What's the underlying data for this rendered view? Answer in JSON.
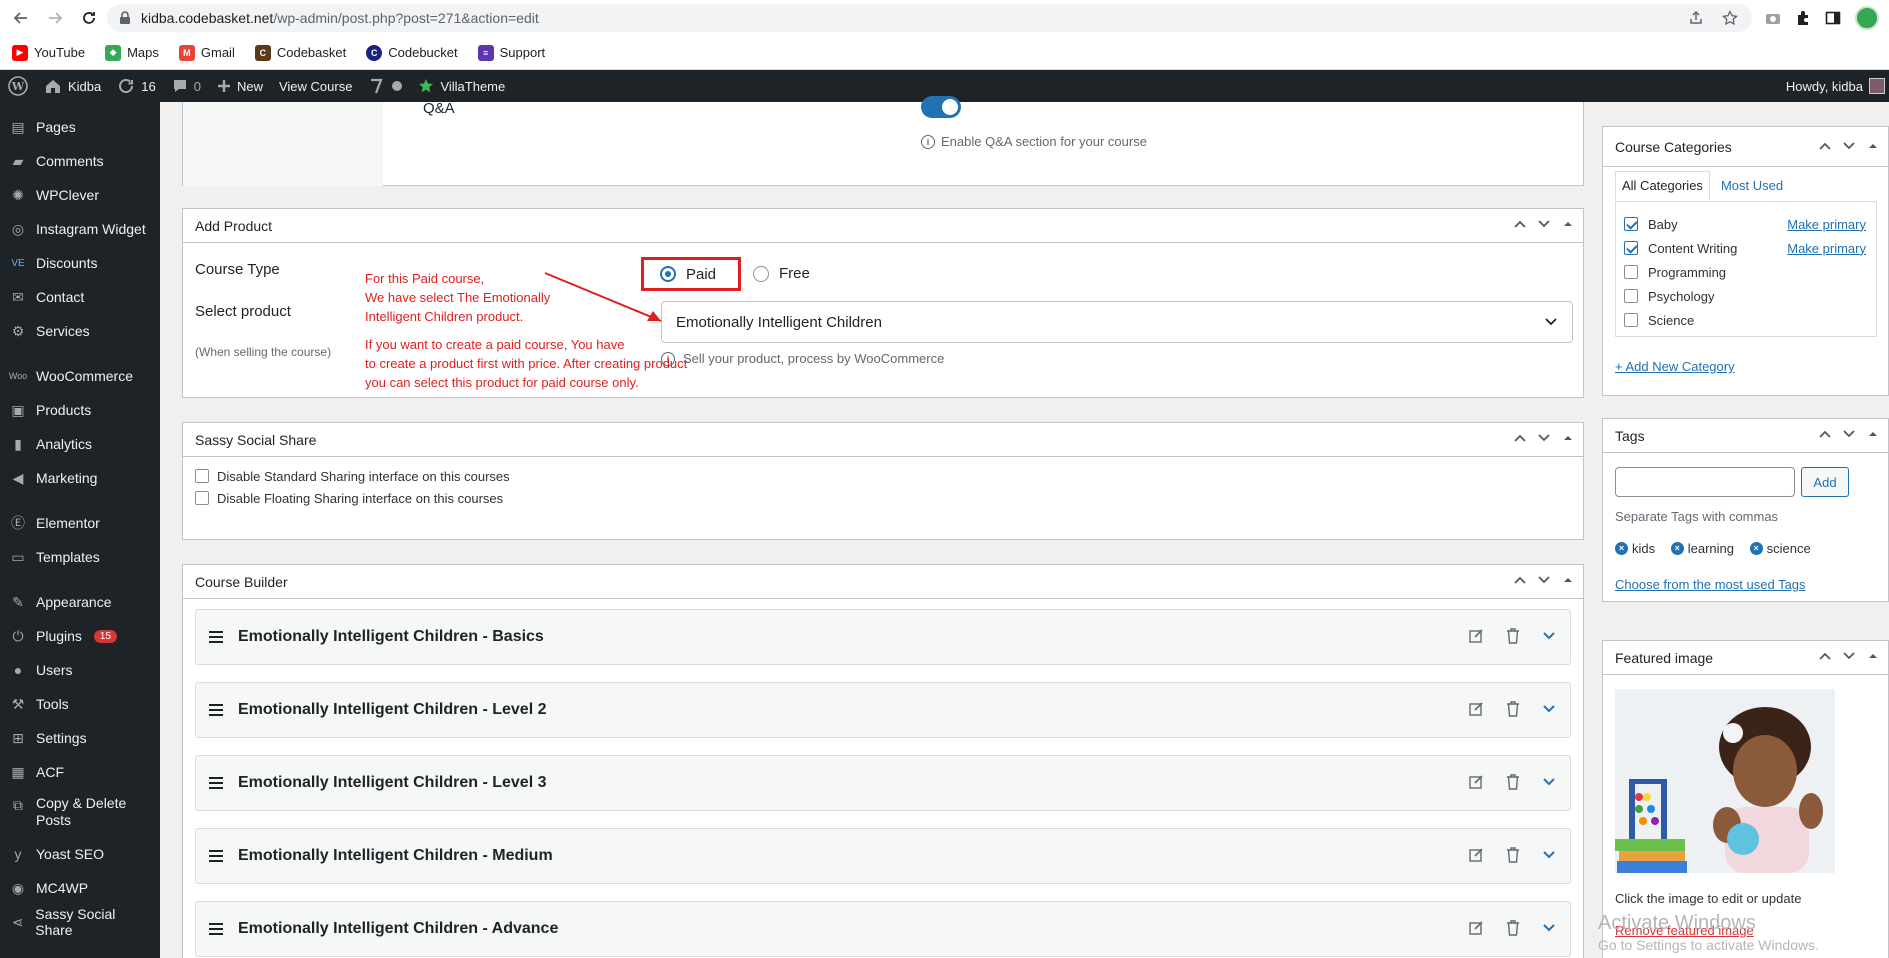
{
  "browser": {
    "url_host": "kidba.codebasket.net",
    "url_path": "/wp-admin/post.php?post=271&action=edit",
    "bookmarks": [
      {
        "label": "YouTube",
        "color": "#ff0000"
      },
      {
        "label": "Maps",
        "color": "#34a853"
      },
      {
        "label": "Gmail",
        "color": "#ea4335"
      },
      {
        "label": "Codebasket",
        "color": "#5b3a1a"
      },
      {
        "label": "Codebucket",
        "color": "#1a237e"
      },
      {
        "label": "Support",
        "color": "#5e35b1"
      }
    ]
  },
  "admin_bar": {
    "site_name": "Kidba",
    "updates_count": "16",
    "comments_count": "0",
    "new_label": "New",
    "view_course_label": "View Course",
    "villatheme_label": "VillaTheme",
    "howdy": "Howdy, kidba"
  },
  "sidebar": {
    "items": [
      {
        "label": "Pages",
        "icon": "pages-icon"
      },
      {
        "label": "Comments",
        "icon": "comments-icon"
      },
      {
        "label": "WPClever",
        "icon": "wpclever-icon"
      },
      {
        "label": "Instagram Widget",
        "icon": "instagram-icon"
      },
      {
        "label": "Discounts",
        "icon": "discounts-icon"
      },
      {
        "label": "Contact",
        "icon": "contact-icon"
      },
      {
        "label": "Services",
        "icon": "services-icon"
      },
      {
        "label": "WooCommerce",
        "icon": "woocommerce-icon"
      },
      {
        "label": "Products",
        "icon": "products-icon"
      },
      {
        "label": "Analytics",
        "icon": "analytics-icon"
      },
      {
        "label": "Marketing",
        "icon": "marketing-icon"
      },
      {
        "label": "Elementor",
        "icon": "elementor-icon"
      },
      {
        "label": "Templates",
        "icon": "templates-icon"
      },
      {
        "label": "Appearance",
        "icon": "appearance-icon"
      },
      {
        "label": "Plugins",
        "icon": "plugins-icon",
        "badge": "15"
      },
      {
        "label": "Users",
        "icon": "users-icon"
      },
      {
        "label": "Tools",
        "icon": "tools-icon"
      },
      {
        "label": "Settings",
        "icon": "settings-icon"
      },
      {
        "label": "ACF",
        "icon": "acf-icon"
      },
      {
        "label": "Copy & Delete Posts",
        "icon": "copy-delete-icon"
      },
      {
        "label": "Yoast SEO",
        "icon": "yoast-icon"
      },
      {
        "label": "MC4WP",
        "icon": "mc4wp-icon"
      },
      {
        "label": "Sassy Social Share",
        "icon": "share-icon"
      }
    ]
  },
  "qa": {
    "label": "Q&A",
    "hint": "Enable Q&A section for your course"
  },
  "add_product": {
    "title": "Add Product",
    "course_type_label": "Course Type",
    "paid_label": "Paid",
    "free_label": "Free",
    "select_product_label": "Select product",
    "when_selling": "(When selling the course)",
    "selected_product": "Emotionally Intelligent Children",
    "sell_hint": "Sell your product, process by WooCommerce",
    "annotation_1": [
      "For this Paid course,",
      "We have select The Emotionally",
      "Intelligent Children product."
    ],
    "annotation_2": [
      "If you want to create a paid course, You have",
      "to create a product first with price. After creating product",
      "you can select this product for paid course only."
    ],
    "annotation_color": "#e01e1e"
  },
  "sassy": {
    "title": "Sassy Social Share",
    "options": [
      "Disable Standard Sharing interface on this courses",
      "Disable Floating Sharing interface on this courses"
    ]
  },
  "course_builder": {
    "title": "Course Builder",
    "topics": [
      "Emotionally Intelligent Children - Basics",
      "Emotionally Intelligent Children - Level 2",
      "Emotionally Intelligent Children - Level 3",
      "Emotionally Intelligent Children - Medium",
      "Emotionally Intelligent Children - Advance"
    ]
  },
  "categories": {
    "title": "Course Categories",
    "tab_all": "All Categories",
    "tab_most_used": "Most Used",
    "items": [
      {
        "label": "Baby",
        "checked": true,
        "primary_link": "Make primary"
      },
      {
        "label": "Content Writing",
        "checked": true,
        "primary_link": "Make primary"
      },
      {
        "label": "Programming",
        "checked": false
      },
      {
        "label": "Psychology",
        "checked": false
      },
      {
        "label": "Science",
        "checked": false
      }
    ],
    "add_new": "+ Add New Category"
  },
  "tags": {
    "title": "Tags",
    "add_button": "Add",
    "hint": "Separate Tags with commas",
    "list": [
      "kids",
      "learning",
      "science"
    ],
    "choose_link": "Choose from the most used Tags"
  },
  "featured": {
    "title": "Featured image",
    "hint": "Click the image to edit or update",
    "remove_link": "Remove featured image"
  },
  "watermark": {
    "line1": "Activate Windows",
    "line2": "Go to Settings to activate Windows."
  }
}
